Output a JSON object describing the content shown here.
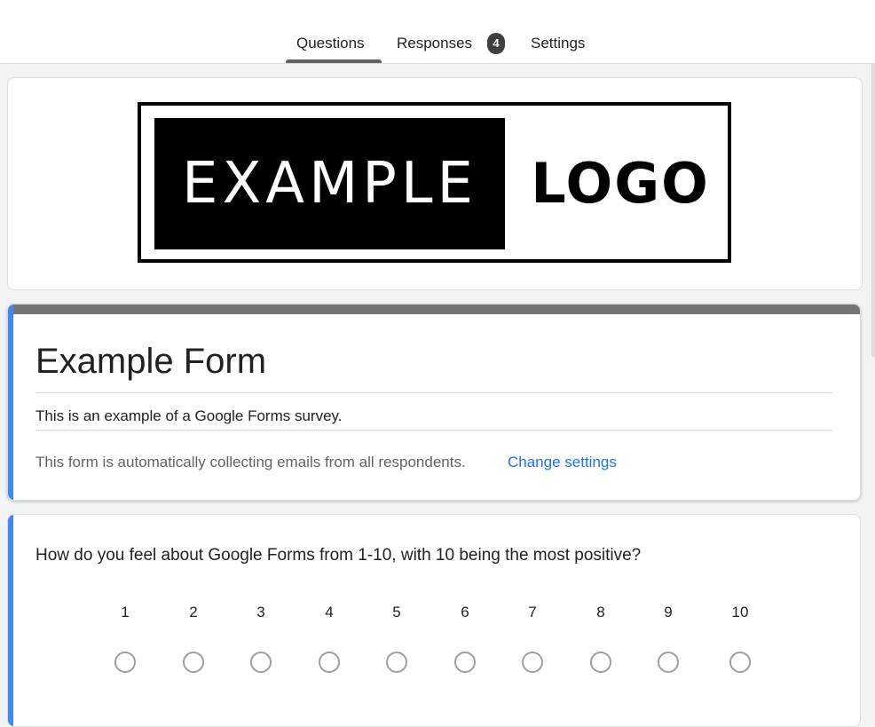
{
  "tabs": {
    "questions": "Questions",
    "responses": "Responses",
    "responses_count": "4",
    "settings": "Settings",
    "active": "Questions"
  },
  "logo": {
    "word1": "EXAMPLE",
    "word2": "LOGO"
  },
  "form": {
    "title": "Example Form",
    "description": "This is an example of a Google Forms survey.",
    "email_note": "This form is automatically collecting emails from all respondents.",
    "change_settings_label": "Change settings"
  },
  "question": {
    "text": "How do you feel about Google Forms from 1-10, with 10 being the most positive?",
    "scale": [
      "1",
      "2",
      "3",
      "4",
      "5",
      "6",
      "7",
      "8",
      "9",
      "10"
    ]
  },
  "colors": {
    "accent": "#4285f4",
    "link": "#1a73e8",
    "header_bar": "#757575",
    "background": "#f1f3f4"
  }
}
